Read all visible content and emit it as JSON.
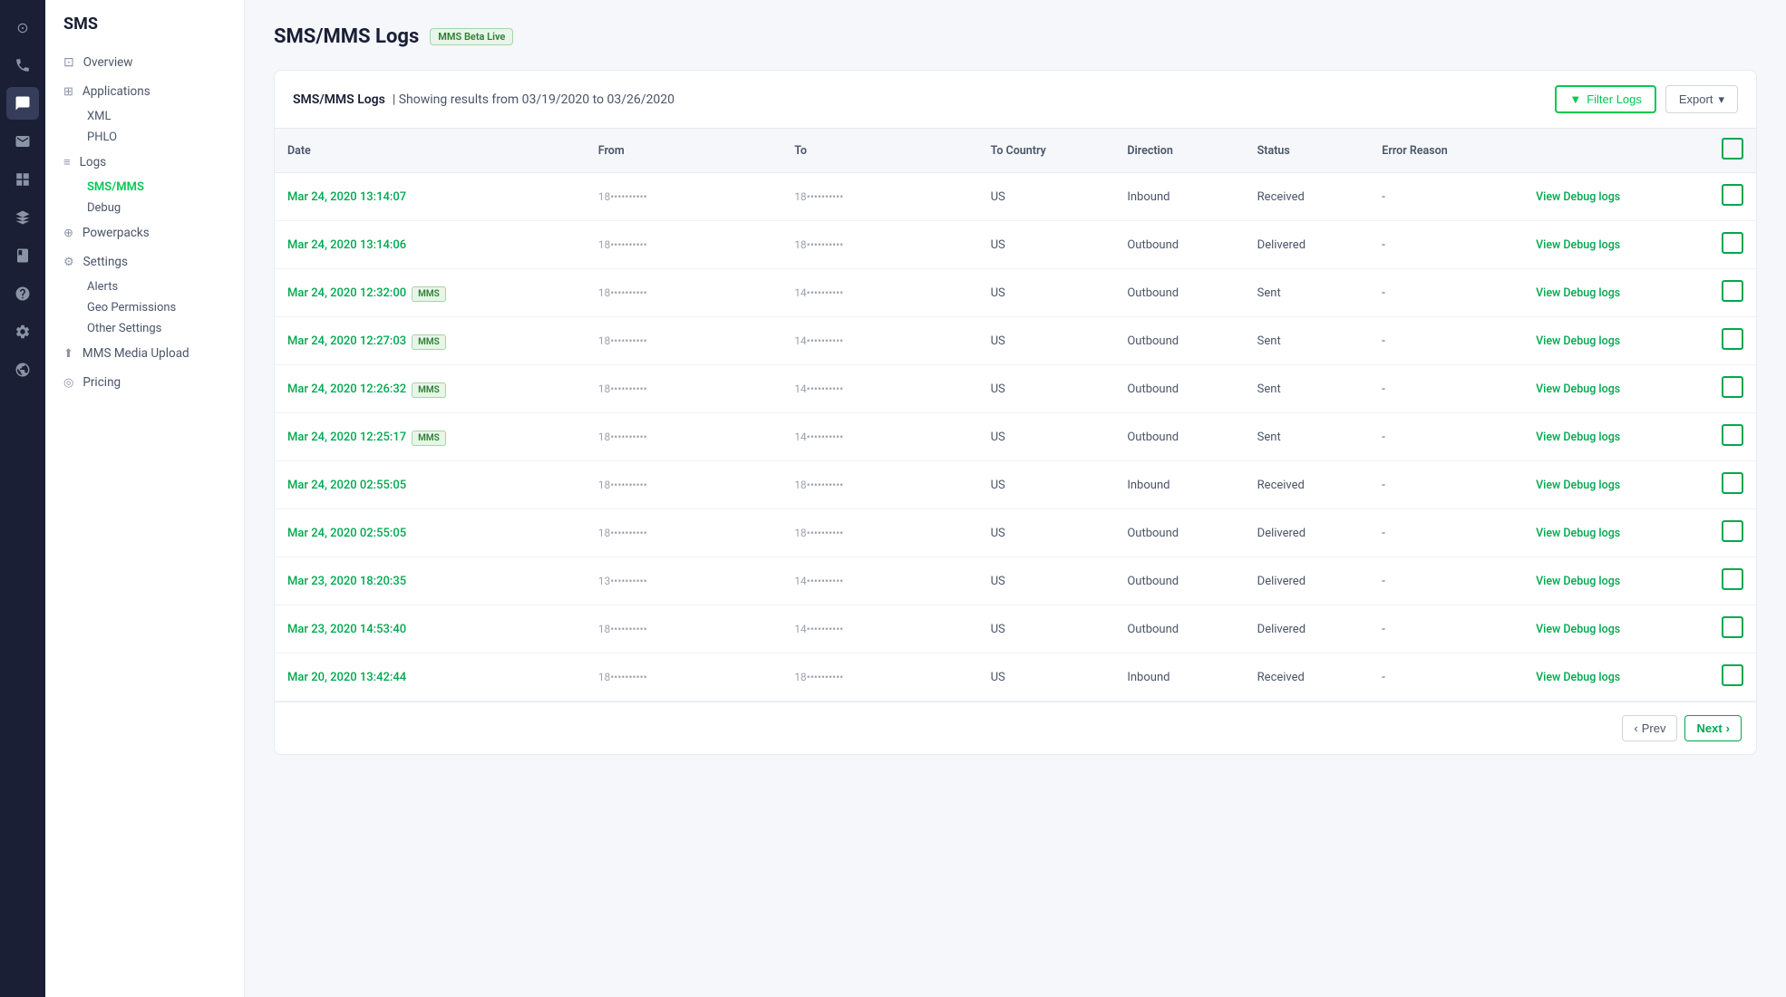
{
  "app": {
    "title": "SMS"
  },
  "iconRail": {
    "icons": [
      {
        "name": "home-icon",
        "symbol": "⊙",
        "active": false
      },
      {
        "name": "phone-icon",
        "symbol": "📞",
        "active": false
      },
      {
        "name": "sms-icon",
        "symbol": "💬",
        "active": true
      },
      {
        "name": "mail-icon",
        "symbol": "✉",
        "active": false
      },
      {
        "name": "grid-icon",
        "symbol": "⊞",
        "active": false
      },
      {
        "name": "layers-icon",
        "symbol": "⧉",
        "active": false
      },
      {
        "name": "book-icon",
        "symbol": "📖",
        "active": false
      },
      {
        "name": "help-icon",
        "symbol": "?",
        "active": false
      },
      {
        "name": "settings-icon",
        "symbol": "⚙",
        "active": false
      },
      {
        "name": "globe-icon",
        "symbol": "🌐",
        "active": false
      }
    ]
  },
  "sidebar": {
    "title": "SMS",
    "items": [
      {
        "id": "overview",
        "label": "Overview",
        "icon": "⊡",
        "active": false,
        "hasChildren": false
      },
      {
        "id": "applications",
        "label": "Applications",
        "icon": "⊞",
        "active": false,
        "hasChildren": true
      },
      {
        "id": "logs",
        "label": "Logs",
        "icon": "≡",
        "active": false,
        "hasChildren": true
      },
      {
        "id": "powerpacks",
        "label": "Powerpacks",
        "icon": "⊕",
        "active": false,
        "hasChildren": false
      },
      {
        "id": "settings",
        "label": "Settings",
        "icon": "⚙",
        "active": false,
        "hasChildren": true
      },
      {
        "id": "mms-media-upload",
        "label": "MMS Media Upload",
        "icon": "⬆",
        "active": false,
        "hasChildren": false
      },
      {
        "id": "pricing",
        "label": "Pricing",
        "icon": "◎",
        "active": false,
        "hasChildren": false
      }
    ],
    "subItems": {
      "applications": [
        "XML",
        "PHLO"
      ],
      "logs": [
        "SMS/MMS",
        "Debug"
      ],
      "settings": [
        "Alerts",
        "Geo Permissions",
        "Other Settings"
      ]
    }
  },
  "page": {
    "title": "SMS/MMS Logs",
    "betaBadge": "MMS Beta Live",
    "filterLogsLabel": "Filter Logs",
    "exportLabel": "Export",
    "logsSubtitle": "SMS/MMS Logs",
    "dateRange": "| Showing results from 03/19/2020 to 03/26/2020"
  },
  "table": {
    "columns": [
      "Date",
      "From",
      "To",
      "To Country",
      "Direction",
      "Status",
      "Error Reason",
      "",
      ""
    ],
    "rows": [
      {
        "date": "Mar 24, 2020 13:14:07",
        "mms": false,
        "from": "18••••••••••",
        "to": "18••••••••••",
        "toCountry": "US",
        "direction": "Inbound",
        "status": "Received",
        "errorReason": "-"
      },
      {
        "date": "Mar 24, 2020 13:14:06",
        "mms": false,
        "from": "18••••••••••",
        "to": "18••••••••••",
        "toCountry": "US",
        "direction": "Outbound",
        "status": "Delivered",
        "errorReason": "-"
      },
      {
        "date": "Mar 24, 2020 12:32:00",
        "mms": true,
        "from": "18••••••••••",
        "to": "14••••••••••",
        "toCountry": "US",
        "direction": "Outbound",
        "status": "Sent",
        "errorReason": "-"
      },
      {
        "date": "Mar 24, 2020 12:27:03",
        "mms": true,
        "from": "18••••••••••",
        "to": "14••••••••••",
        "toCountry": "US",
        "direction": "Outbound",
        "status": "Sent",
        "errorReason": "-"
      },
      {
        "date": "Mar 24, 2020 12:26:32",
        "mms": true,
        "from": "18••••••••••",
        "to": "14••••••••••",
        "toCountry": "US",
        "direction": "Outbound",
        "status": "Sent",
        "errorReason": "-"
      },
      {
        "date": "Mar 24, 2020 12:25:17",
        "mms": true,
        "from": "18••••••••••",
        "to": "14••••••••••",
        "toCountry": "US",
        "direction": "Outbound",
        "status": "Sent",
        "errorReason": "-"
      },
      {
        "date": "Mar 24, 2020 02:55:05",
        "mms": false,
        "from": "18••••••••••",
        "to": "18••••••••••",
        "toCountry": "US",
        "direction": "Inbound",
        "status": "Received",
        "errorReason": "-"
      },
      {
        "date": "Mar 24, 2020 02:55:05",
        "mms": false,
        "from": "18••••••••••",
        "to": "18••••••••••",
        "toCountry": "US",
        "direction": "Outbound",
        "status": "Delivered",
        "errorReason": "-"
      },
      {
        "date": "Mar 23, 2020 18:20:35",
        "mms": false,
        "from": "13••••••••••",
        "to": "14••••••••••",
        "toCountry": "US",
        "direction": "Outbound",
        "status": "Delivered",
        "errorReason": "-"
      },
      {
        "date": "Mar 23, 2020 14:53:40",
        "mms": false,
        "from": "18••••••••••",
        "to": "14••••••••••",
        "toCountry": "US",
        "direction": "Outbound",
        "status": "Delivered",
        "errorReason": "-"
      },
      {
        "date": "Mar 20, 2020 13:42:44",
        "mms": false,
        "from": "18••••••••••",
        "to": "18••••••••••",
        "toCountry": "US",
        "direction": "Inbound",
        "status": "Received",
        "errorReason": "-"
      }
    ],
    "viewDebugLabel": "View Debug logs",
    "mmsBadgeLabel": "MMS"
  },
  "pagination": {
    "prevLabel": "Prev",
    "nextLabel": "Next"
  }
}
